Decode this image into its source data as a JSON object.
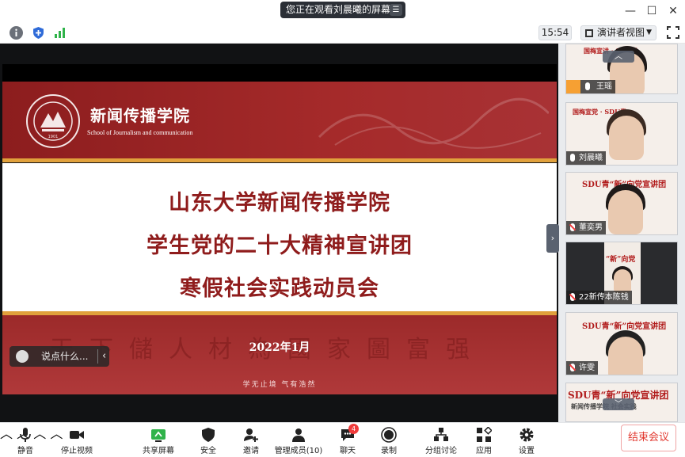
{
  "titlebar": {
    "banner_text": "您正在观看刘晨曦的屏幕",
    "menu_icon": "hamburger-icon"
  },
  "toolbar": {
    "clock": "15:54",
    "view_mode": "演讲者视图"
  },
  "slide": {
    "school_cn": "新闻传播学院",
    "school_en": "School of Journalism and communication",
    "title_lines": [
      "山东大学新闻传播学院",
      "学生党的二十大精神宣讲团",
      "寒假社会实践动员会"
    ],
    "date": "2022年1月",
    "motto": "学无止境  气有浩然",
    "calligraphy": "天下儲人材為國家圖富强",
    "logo_year": "1901"
  },
  "chat": {
    "placeholder": "说点什么..."
  },
  "participants": [
    {
      "name": "王瑶",
      "muted": false
    },
    {
      "name": "刘晨曦",
      "muted": false
    },
    {
      "name": "董奕男",
      "muted": true
    },
    {
      "name": "22新传本陈钱",
      "muted": true
    },
    {
      "name": "许雯",
      "muted": true
    },
    {
      "name": "",
      "muted": false
    }
  ],
  "bottombar": {
    "mute": "静音",
    "stop_video": "停止视频",
    "share_screen": "共享屏幕",
    "security": "安全",
    "invite": "邀请",
    "manage": "管理成员(10)",
    "chat": "聊天",
    "chat_badge": "4",
    "record": "录制",
    "breakout": "分组讨论",
    "apps": "应用",
    "settings": "设置",
    "end_meeting": "结束会议"
  },
  "colors": {
    "accent_red": "#a52a2a",
    "gold": "#e1a13c",
    "end_red": "#e2382f"
  }
}
